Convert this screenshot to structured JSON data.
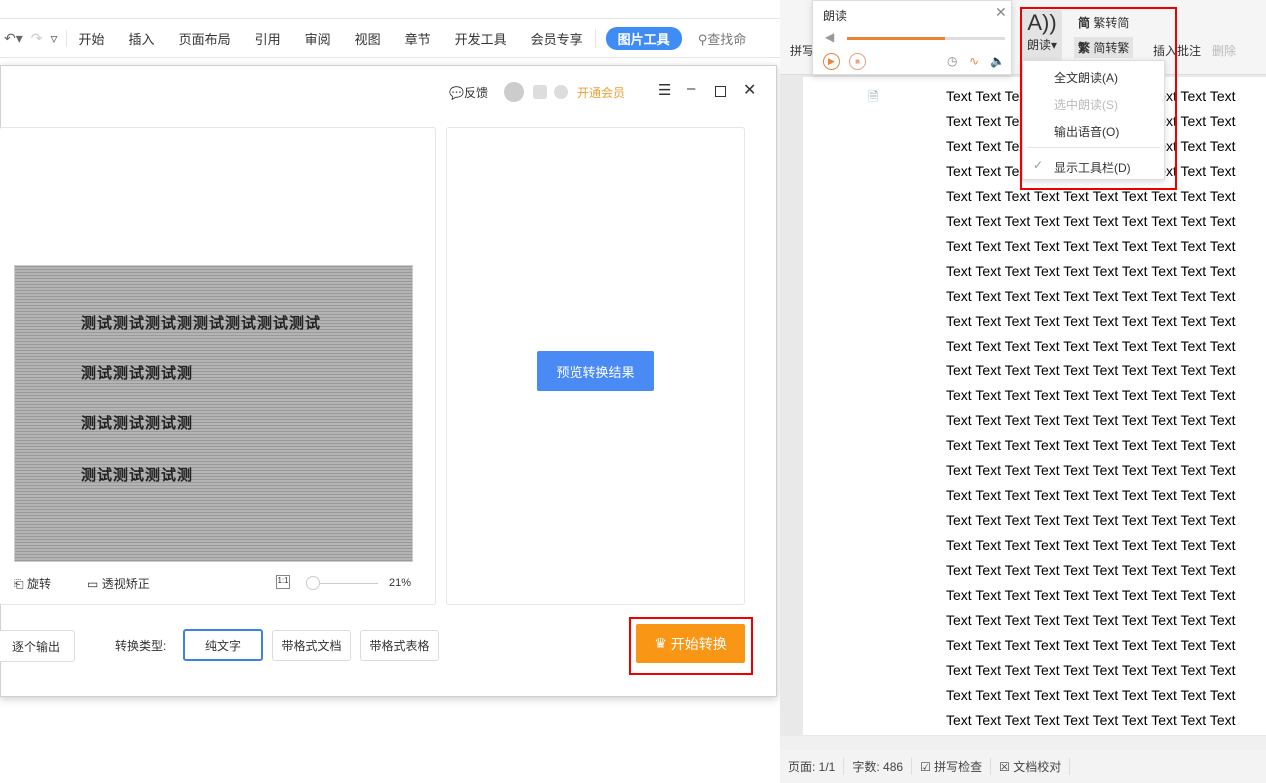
{
  "ribbon": {
    "tabs": [
      "开始",
      "插入",
      "页面布局",
      "引用",
      "审阅",
      "视图",
      "章节",
      "开发工具",
      "会员专享"
    ],
    "active_tool": "图片工具",
    "search": "查找命",
    "accent": "#3f8cf5"
  },
  "dialog": {
    "feedback": "反馈",
    "vip": "开通会员",
    "rotate": "旋转",
    "perspective": "透视矫正",
    "zoom": "21%",
    "preview_button": "预览转换结果",
    "output_mode": "逐个输出",
    "convert_type_label": "转换类型:",
    "types": [
      "纯文字",
      "带格式文档",
      "带格式表格"
    ],
    "selected_type": "纯文字",
    "start_button": "开始转换",
    "start_color": "#fa9616",
    "photo_lines": [
      "测试测试测试测测试测试测试测试",
      "测试测试测试测",
      "测试测试测试测",
      "测试测试测试测"
    ]
  },
  "word_ribbon": {
    "pinyin": "拼写",
    "read": "朗读",
    "trad_to_simp": "繁转简",
    "simp_to_trad": "简转繁",
    "insert_comment": "插入批注",
    "delete": "删除"
  },
  "reader": {
    "title": "朗读",
    "volume_percent": 62
  },
  "read_menu": {
    "items": [
      {
        "label": "全文朗读(A)",
        "enabled": true
      },
      {
        "label": "选中朗读(S)",
        "enabled": false
      },
      {
        "label": "输出语音(O)",
        "enabled": true
      },
      {
        "label": "显示工具栏(D)",
        "enabled": true,
        "checked": true
      }
    ]
  },
  "document": {
    "lines": [
      "Text Text Text Text Text Text Text Text Text Text",
      "Text Text Text Text Text Text Text Text Text Text",
      "Text Text Text Text Text Text Text Text Text Text",
      "Text Text Text Text Text Text Text Text Text Text",
      "Text Text Text Text Text Text Text Text Text Text",
      "Text Text Text Text Text Text Text Text Text Text",
      "Text Text Text Text Text Text Text Text Text Text",
      "Text Text Text Text Text Text Text Text Text Text",
      "Text Text Text Text Text Text Text Text Text Text",
      "Text Text Text Text Text Text Text Text Text Text",
      "Text Text Text Text Text Text Text Text Text Text",
      "Text Text Text Text Text Text Text Text Text Text",
      "Text Text Text Text Text Text Text Text Text Text",
      "Text Text Text Text Text Text Text Text Text Text",
      "Text Text Text Text Text Text Text Text Text Text",
      "Text Text Text Text Text Text Text Text Text Text",
      "Text Text Text Text Text Text Text Text Text Text",
      "Text Text Text Text Text Text Text Text Text Text",
      "Text Text Text Text Text Text Text Text Text Text",
      "Text Text Text Text Text Text Text Text Text Text",
      "Text Text Text Text Text Text Text Text Text Text",
      "Text Text Text Text Text Text Text Text Text Text",
      "Text Text Text Text Text Text Text Text Text Text",
      "Text Text Text Text Text Text Text Text Text Text",
      "Text Text Text Text Text Text Text Text Text Text",
      "Text Text Text Text Text Text Text Text Text Text"
    ]
  },
  "status": {
    "page": "页面: 1/1",
    "words": "字数: 486",
    "spell": "拼写检查",
    "proof": "文档校对"
  }
}
